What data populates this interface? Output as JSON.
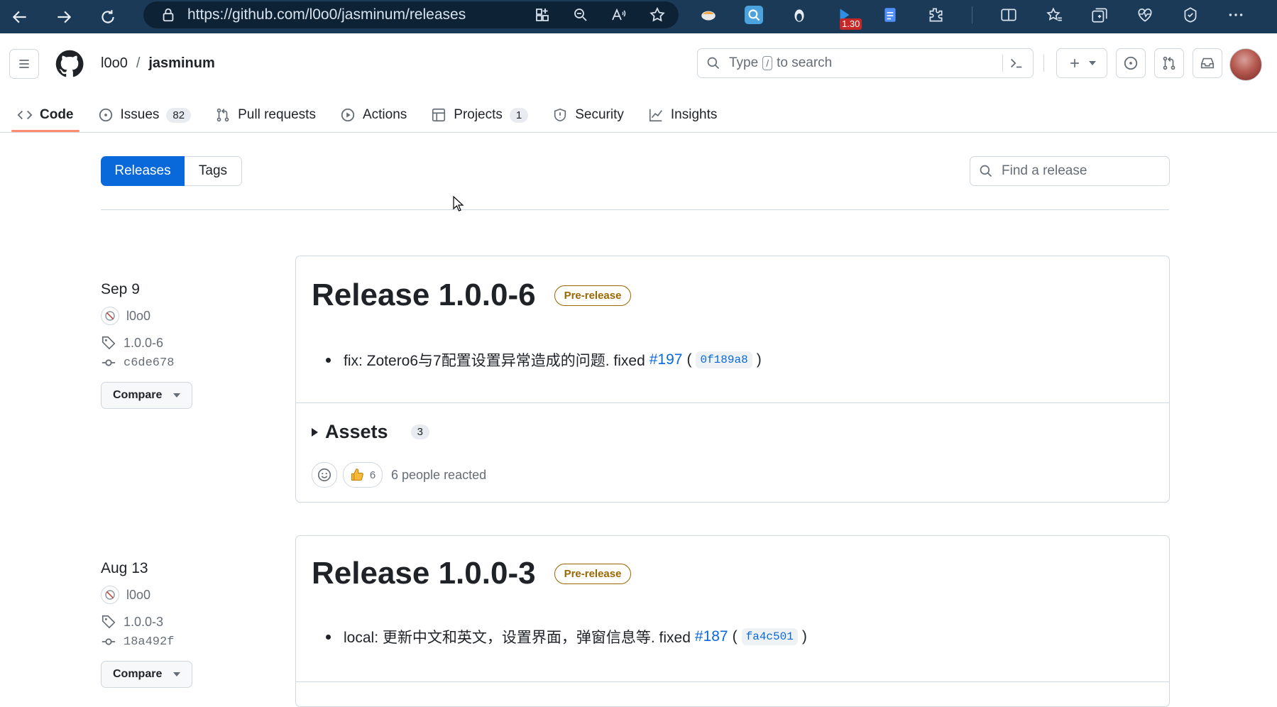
{
  "browser": {
    "url": "https://github.com/l0o0/jasminum/releases",
    "extension_badge": "1.30"
  },
  "header": {
    "owner": "l0o0",
    "separator": "/",
    "repo": "jasminum",
    "search_prefix": "Type",
    "search_key": "/",
    "search_suffix": "to search"
  },
  "repo_nav": {
    "tabs": [
      {
        "label": "Code",
        "icon": "code-icon"
      },
      {
        "label": "Issues",
        "icon": "issue-opened-icon",
        "count": "82"
      },
      {
        "label": "Pull requests",
        "icon": "git-pull-request-icon"
      },
      {
        "label": "Actions",
        "icon": "play-icon"
      },
      {
        "label": "Projects",
        "icon": "table-icon",
        "count": "1"
      },
      {
        "label": "Security",
        "icon": "shield-icon"
      },
      {
        "label": "Insights",
        "icon": "graph-icon"
      }
    ]
  },
  "subnav": {
    "releases_label": "Releases",
    "tags_label": "Tags",
    "find_placeholder": "Find a release"
  },
  "releases": [
    {
      "date": "Sep 9",
      "author": "l0o0",
      "tag": "1.0.0-6",
      "commit": "c6de678",
      "compare_label": "Compare",
      "title": "Release 1.0.0-6",
      "badge": "Pre-release",
      "note_text": "fix: Zotero6与7配置设置异常造成的问题. fixed",
      "note_issue": "#197",
      "note_sha": "0f189a8",
      "assets_label": "Assets",
      "assets_count": "3",
      "reaction_count": "6",
      "reacted_text": "6 people reacted"
    },
    {
      "date": "Aug 13",
      "author": "l0o0",
      "tag": "1.0.0-3",
      "commit": "18a492f",
      "compare_label": "Compare",
      "title": "Release 1.0.0-3",
      "badge": "Pre-release",
      "note_text": "local: 更新中文和英文，设置界面，弹窗信息等. fixed",
      "note_issue": "#187",
      "note_sha": "fa4c501"
    }
  ],
  "punct": {
    "open_paren": "(",
    "close_paren": ")"
  }
}
